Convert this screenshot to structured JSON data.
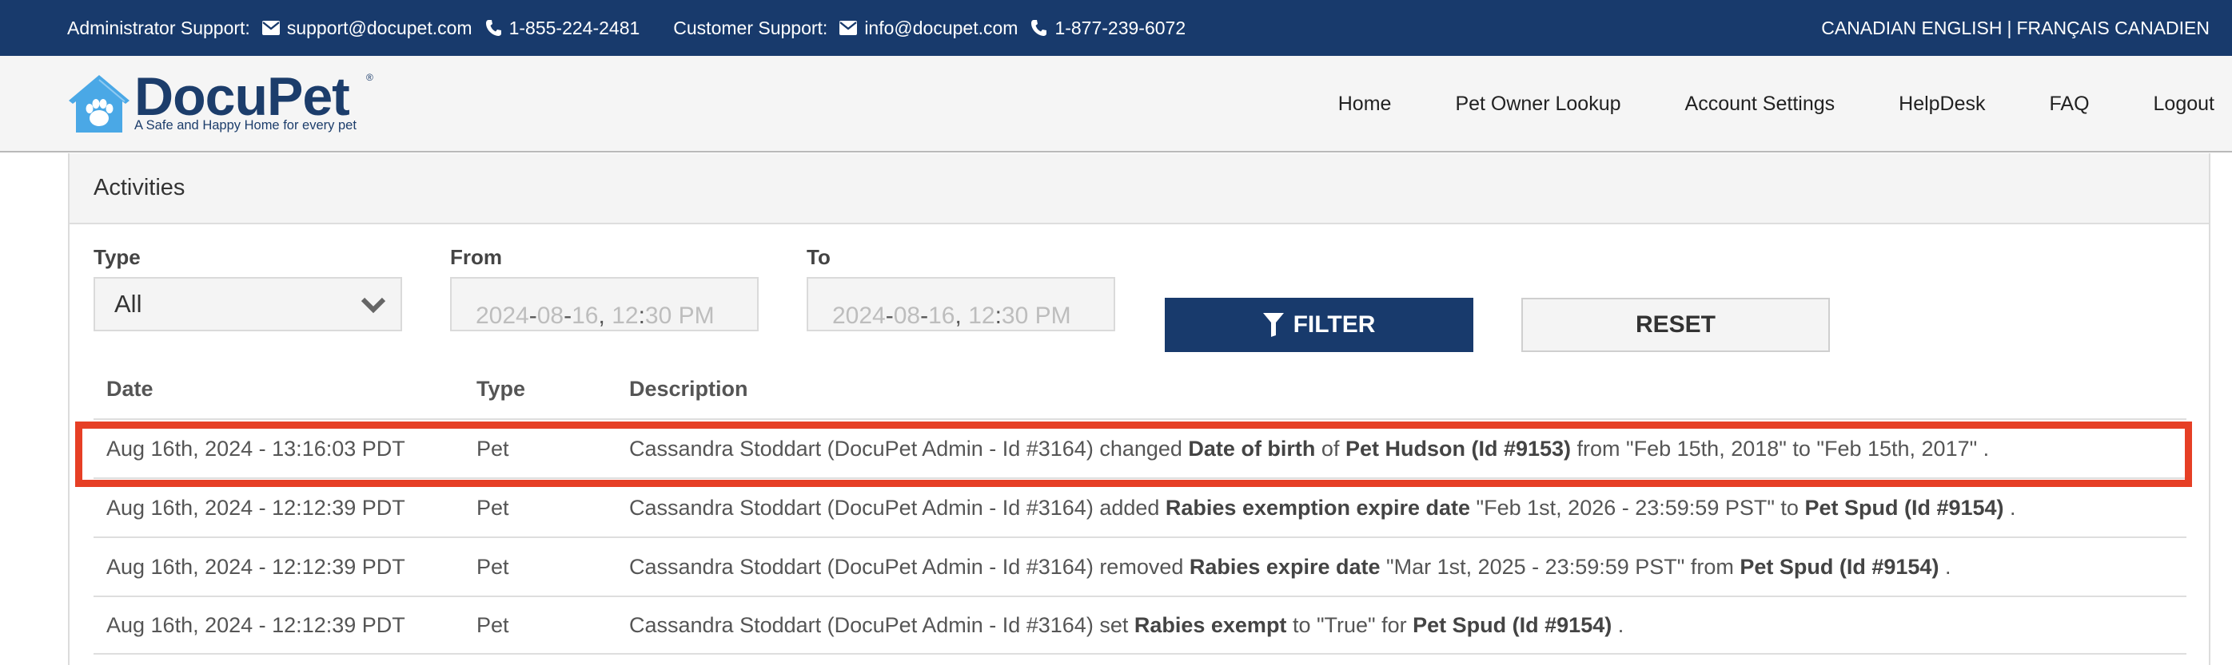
{
  "topbar": {
    "admin_label": "Administrator Support:",
    "admin_email": "support@docupet.com",
    "admin_phone": "1-855-224-2481",
    "customer_label": "Customer Support:",
    "customer_email": "info@docupet.com",
    "customer_phone": "1-877-239-6072",
    "lang_en": "CANADIAN ENGLISH",
    "lang_sep": "|",
    "lang_fr": "FRANÇAIS CANADIEN"
  },
  "logo": {
    "name": "DocuPet",
    "reg": "®",
    "tagline": "A Safe and Happy Home for every pet"
  },
  "nav": [
    "Home",
    "Pet Owner Lookup",
    "Account Settings",
    "HelpDesk",
    "FAQ",
    "Logout"
  ],
  "panel": {
    "title": "Activities",
    "filters": {
      "type_label": "Type",
      "type_value": "All",
      "from_label": "From",
      "from_value": {
        "year": "2024",
        "month": "08",
        "day": "16",
        "hour": "12",
        "minute": "30",
        "ampm": "PM"
      },
      "to_label": "To",
      "to_value": {
        "year": "2024",
        "month": "08",
        "day": "16",
        "hour": "12",
        "minute": "30",
        "ampm": "PM"
      },
      "filter_button": "FILTER",
      "reset_button": "RESET"
    },
    "table": {
      "headers": [
        "Date",
        "Type",
        "Description"
      ],
      "rows": [
        {
          "date": "Aug 16th, 2024 - 13:16:03 PDT",
          "type": "Pet",
          "desc": [
            {
              "t": "Cassandra Stoddart (DocuPet Admin - Id #3164) changed ",
              "b": false
            },
            {
              "t": "Date of birth",
              "b": true
            },
            {
              "t": " of ",
              "b": false
            },
            {
              "t": "Pet Hudson (Id #9153)",
              "b": true
            },
            {
              "t": " from \"Feb 15th, 2018\" to \"Feb 15th, 2017\" .",
              "b": false
            }
          ],
          "highlighted": true
        },
        {
          "date": "Aug 16th, 2024 - 12:12:39 PDT",
          "type": "Pet",
          "desc": [
            {
              "t": "Cassandra Stoddart (DocuPet Admin - Id #3164) added ",
              "b": false
            },
            {
              "t": "Rabies exemption expire date",
              "b": true
            },
            {
              "t": " \"Feb 1st, 2026 - 23:59:59 PST\" to ",
              "b": false
            },
            {
              "t": "Pet Spud (Id #9154)",
              "b": true
            },
            {
              "t": " .",
              "b": false
            }
          ]
        },
        {
          "date": "Aug 16th, 2024 - 12:12:39 PDT",
          "type": "Pet",
          "desc": [
            {
              "t": "Cassandra Stoddart (DocuPet Admin - Id #3164) removed ",
              "b": false
            },
            {
              "t": "Rabies expire date",
              "b": true
            },
            {
              "t": " \"Mar 1st, 2025 - 23:59:59 PST\" from ",
              "b": false
            },
            {
              "t": "Pet Spud (Id #9154)",
              "b": true
            },
            {
              "t": " .",
              "b": false
            }
          ]
        },
        {
          "date": "Aug 16th, 2024 - 12:12:39 PDT",
          "type": "Pet",
          "desc": [
            {
              "t": "Cassandra Stoddart (DocuPet Admin - Id #3164) set ",
              "b": false
            },
            {
              "t": "Rabies exempt",
              "b": true
            },
            {
              "t": " to \"True\" for ",
              "b": false
            },
            {
              "t": "Pet Spud (Id #9154)",
              "b": true
            },
            {
              "t": " .",
              "b": false
            }
          ]
        }
      ]
    }
  },
  "colors": {
    "brand_navy": "#183a6c",
    "logo_blue": "#4aa8e6",
    "highlight_red": "#e63f25"
  },
  "icons": {
    "email": "envelope-icon",
    "phone": "phone-icon",
    "filter": "funnel-icon",
    "dropdown": "chevron-down-icon",
    "logo": "paw-house-icon"
  }
}
